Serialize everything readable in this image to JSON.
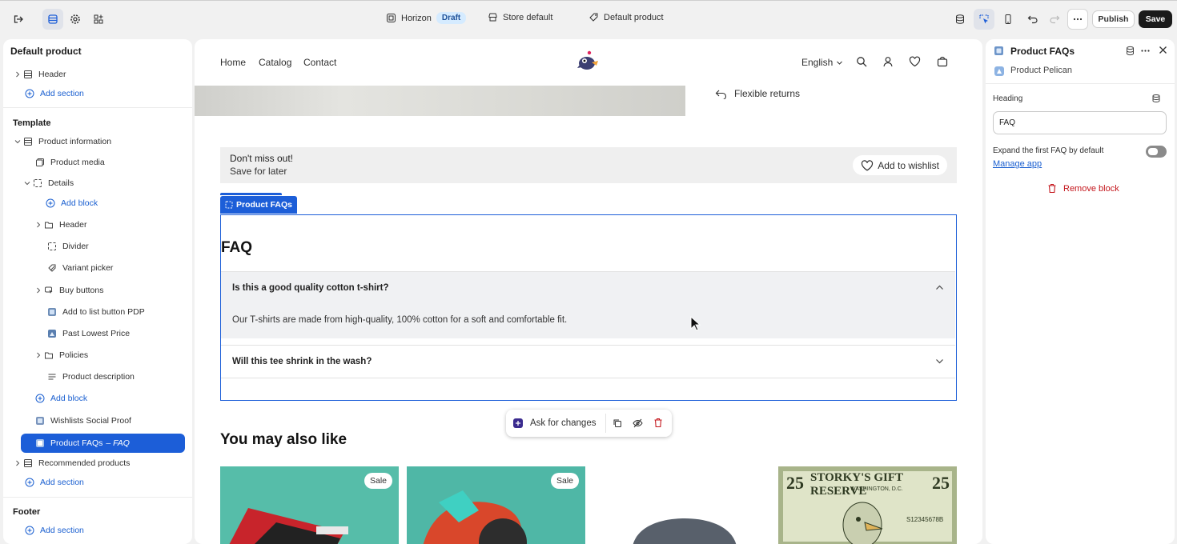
{
  "topbar": {
    "theme_name": "Horizon",
    "theme_status": "Draft",
    "store": "Store default",
    "template": "Default product",
    "publish_label": "Publish",
    "save_label": "Save"
  },
  "left_panel": {
    "title": "Default product",
    "header_item": "Header",
    "add_section_1": "Add section",
    "template_heading": "Template",
    "product_information": "Product information",
    "product_media": "Product media",
    "details": "Details",
    "add_block_inner": "Add block",
    "header_block": "Header",
    "divider": "Divider",
    "variant_picker": "Variant picker",
    "buy_buttons": "Buy buttons",
    "add_to_list": "Add to list button PDP",
    "past_lowest": "Past Lowest Price",
    "policies": "Policies",
    "product_description": "Product description",
    "add_block_outer": "Add block",
    "wishlists_social": "Wishlists Social Proof",
    "product_faqs": "Product FAQs",
    "product_faqs_sub": "– FAQ",
    "recommended": "Recommended products",
    "add_section_2": "Add section",
    "footer_heading": "Footer",
    "add_section_3": "Add section"
  },
  "store_nav": {
    "links": [
      "Home",
      "Catalog",
      "Contact"
    ],
    "language": "English"
  },
  "preview": {
    "flexible_returns": "Flexible returns",
    "banner_title": "Don't miss out!",
    "banner_sub": "Save for later",
    "wishlist_btn": "Add to wishlist",
    "block_tag": "Product FAQs",
    "faq_heading": "FAQ",
    "faqs": [
      {
        "q": "Is this a good quality cotton t-shirt?",
        "a": "Our T-shirts are made from high-quality, 100% cotton for a soft and comfortable fit."
      },
      {
        "q": "Will this tee shrink in the wash?"
      }
    ],
    "ask_changes": "Ask for changes",
    "also_like": "You may also like",
    "sale_badge": "Sale",
    "bill_text": "STORKY'S GIFT RESERVE",
    "bill_small": "WASHINGTON, D.C.",
    "bill_serial": "S12345678B",
    "bill_num": "25"
  },
  "right_panel": {
    "title": "Product FAQs",
    "app_name": "Product Pelican",
    "heading_label": "Heading",
    "heading_value": "FAQ",
    "expand_label": "Expand the first FAQ by default",
    "manage_app": "Manage app",
    "remove_block": "Remove block"
  },
  "colors": {
    "accent": "#1c5ed8",
    "danger": "#c4161c",
    "save_bg": "#1a1a1a"
  }
}
